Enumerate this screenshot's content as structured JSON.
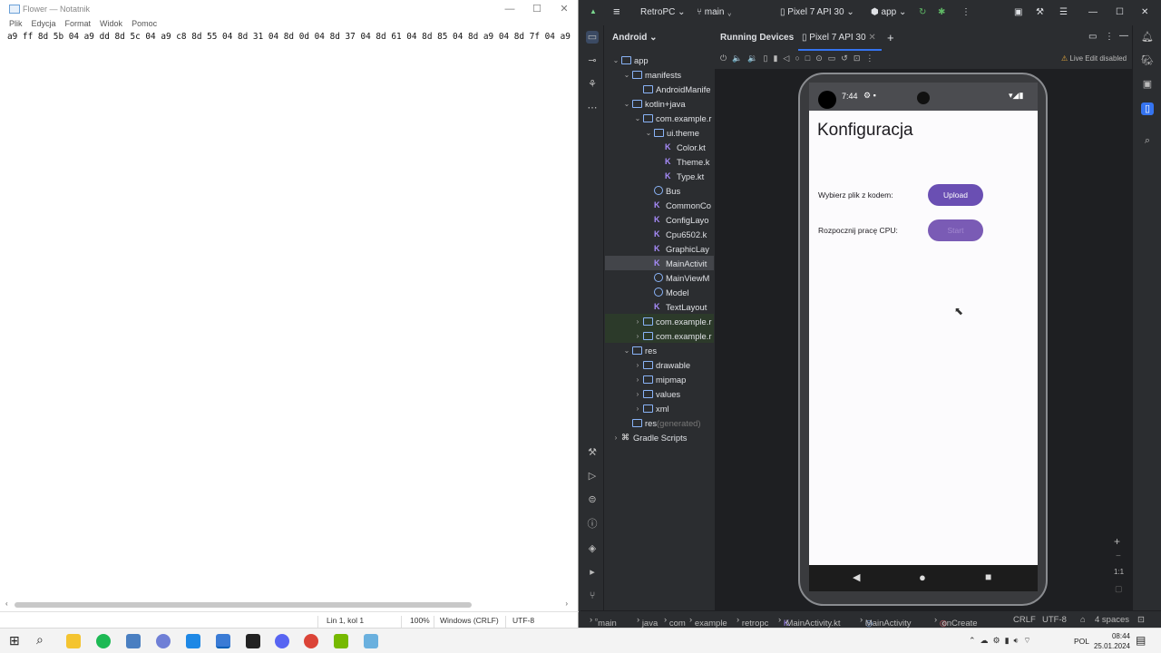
{
  "notepad": {
    "title": "Flower — Notatnik",
    "menu": [
      "Plik",
      "Edycja",
      "Format",
      "Widok",
      "Pomoc"
    ],
    "content": "a9 ff 8d 5b 04 a9 dd 8d 5c 04 a9 c8 8d 55 04 8d 31 04 8d 0d 04 8d 37 04 8d 61 04 8d 85 04 8d a9 04 8d 7f 04 a9 64 8d",
    "status": {
      "position": "Lin 1, kol 1",
      "zoom": "100%",
      "line_ending": "Windows (CRLF)",
      "encoding": "UTF-8"
    },
    "window_controls": [
      "—",
      "☐",
      "✕"
    ]
  },
  "studio": {
    "project": "RetroPC",
    "branch": "main",
    "device": "Pixel 7 API 30",
    "run_config": "app",
    "project_view": "Android",
    "live_edit": "Live Edit disabled",
    "tabs": {
      "running": "Running Devices",
      "device_tab": "Pixel 7 API 30"
    },
    "tree": [
      {
        "label": "app",
        "indent": 0,
        "chev": "⌄",
        "icon": "folder"
      },
      {
        "label": "manifests",
        "indent": 1,
        "chev": "⌄",
        "icon": "folder"
      },
      {
        "label": "AndroidManife",
        "indent": 2,
        "chev": "",
        "icon": "folder"
      },
      {
        "label": "kotlin+java",
        "indent": 1,
        "chev": "⌄",
        "icon": "folder"
      },
      {
        "label": "com.example.r",
        "indent": 2,
        "chev": "⌄",
        "icon": "folder"
      },
      {
        "label": "ui.theme",
        "indent": 3,
        "chev": "⌄",
        "icon": "folder"
      },
      {
        "label": "Color.kt",
        "indent": 4,
        "chev": "",
        "icon": "kt"
      },
      {
        "label": "Theme.k",
        "indent": 4,
        "chev": "",
        "icon": "kt"
      },
      {
        "label": "Type.kt",
        "indent": 4,
        "chev": "",
        "icon": "kt"
      },
      {
        "label": "Bus",
        "indent": 3,
        "chev": "",
        "icon": "cls"
      },
      {
        "label": "CommonCo",
        "indent": 3,
        "chev": "",
        "icon": "kt"
      },
      {
        "label": "ConfigLayo",
        "indent": 3,
        "chev": "",
        "icon": "kt"
      },
      {
        "label": "Cpu6502.k",
        "indent": 3,
        "chev": "",
        "icon": "kt"
      },
      {
        "label": "GraphicLay",
        "indent": 3,
        "chev": "",
        "icon": "kt"
      },
      {
        "label": "MainActivit",
        "indent": 3,
        "chev": "",
        "icon": "kt",
        "selected": true
      },
      {
        "label": "MainViewM",
        "indent": 3,
        "chev": "",
        "icon": "cls"
      },
      {
        "label": "Model",
        "indent": 3,
        "chev": "",
        "icon": "cls"
      },
      {
        "label": "TextLayout",
        "indent": 3,
        "chev": "",
        "icon": "kt"
      },
      {
        "label": "com.example.r",
        "indent": 2,
        "chev": "›",
        "icon": "folder",
        "green": true
      },
      {
        "label": "com.example.r",
        "indent": 2,
        "chev": "›",
        "icon": "folder",
        "green": true
      },
      {
        "label": "res",
        "indent": 1,
        "chev": "⌄",
        "icon": "folder"
      },
      {
        "label": "drawable",
        "indent": 2,
        "chev": "›",
        "icon": "folder"
      },
      {
        "label": "mipmap",
        "indent": 2,
        "chev": "›",
        "icon": "folder"
      },
      {
        "label": "values",
        "indent": 2,
        "chev": "›",
        "icon": "folder"
      },
      {
        "label": "xml",
        "indent": 2,
        "chev": "›",
        "icon": "folder"
      },
      {
        "label": "res",
        "suffix": " (generated)",
        "indent": 1,
        "chev": "",
        "icon": "folder"
      },
      {
        "label": "Gradle Scripts",
        "indent": 0,
        "chev": "›",
        "icon": "gradle"
      }
    ],
    "breadcrumb": [
      "main",
      "java",
      "com",
      "example",
      "retropc",
      "MainActivity.kt",
      "MainActivity",
      "onCreate"
    ],
    "status_right": [
      "CRLF",
      "UTF-8",
      "4 spaces"
    ],
    "zoom_controls": [
      "+",
      "−",
      "1:1"
    ]
  },
  "phone": {
    "time": "7:44",
    "title": "Konfiguracja",
    "row1_label": "Wybierz plik z kodem:",
    "row1_button": "Upload",
    "row2_label": "Rozpocznij pracę CPU:",
    "row2_button": "Start"
  },
  "taskbar": {
    "time": "08:44",
    "date": "25.01.2024",
    "lang": "POL"
  },
  "colors": {
    "accent": "#6a4fb3",
    "ide_bg": "#2b2d30",
    "ide_dark": "#1e1f22"
  }
}
